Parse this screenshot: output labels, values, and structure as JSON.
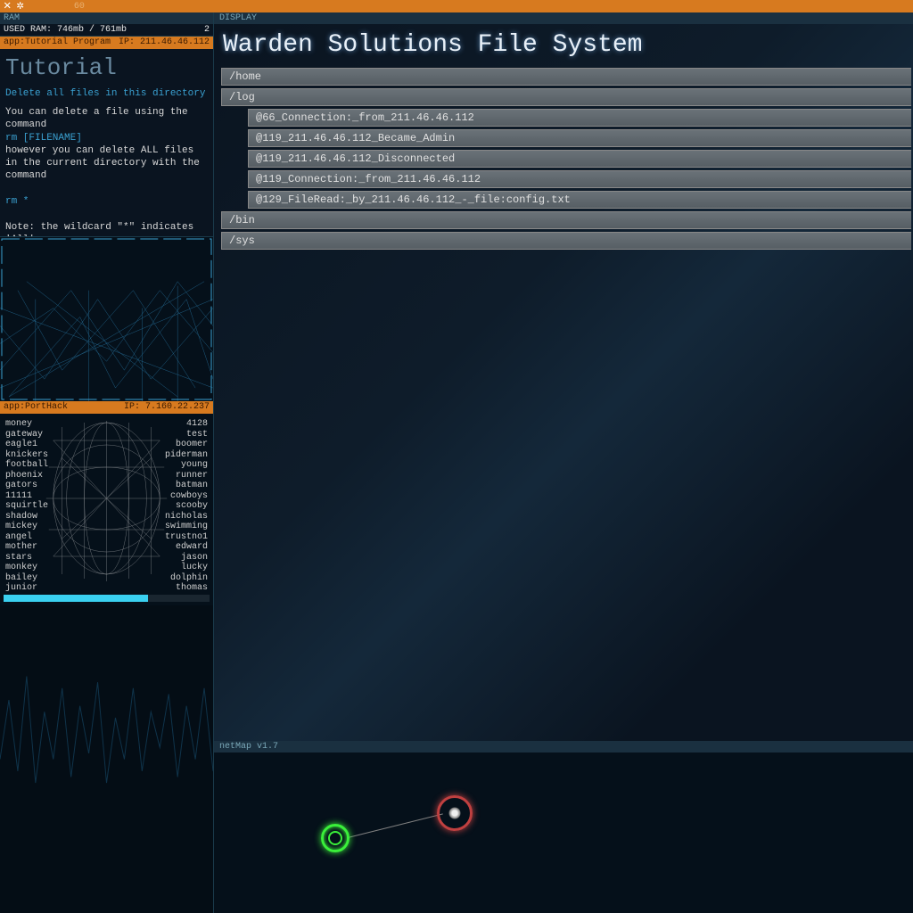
{
  "topbar": {
    "fps": "60"
  },
  "ram": {
    "label": "RAM",
    "used_line": "USED RAM: 746mb / 761mb",
    "count": "2",
    "app_tutorial": "app:Tutorial Program",
    "ip_tutorial": "IP: 211.46.46.112"
  },
  "tutorial": {
    "title": "Tutorial",
    "subtitle": "Delete all files in this directory",
    "line1": "You can delete a file using the command",
    "cmd1": "rm [FILENAME]",
    "line2": "however you can delete ALL files in the current directory with the command",
    "cmd2": "rm *",
    "note": "Note: the wildcard \"*\" indicates 'All'."
  },
  "porthack": {
    "app": "app:PortHack",
    "ip": "IP: 7.160.22.237",
    "left_words": [
      "money",
      "gateway",
      "eagle1",
      "knickers",
      "football",
      "phoenix",
      "gators",
      "11111",
      "squirtle",
      "shadow",
      "mickey",
      "angel",
      "mother",
      "stars",
      "monkey",
      "bailey",
      "junior"
    ],
    "right_words": [
      "4128",
      "test",
      "boomer",
      "piderman",
      "young",
      "runner",
      "batman",
      "cowboys",
      "scooby",
      "nicholas",
      "swimming",
      "trustno1",
      "edward",
      "jason",
      "lucky",
      "dolphin",
      "thomas"
    ]
  },
  "display": {
    "header": "DISPLAY",
    "title": "Warden Solutions File System",
    "rows": [
      {
        "label": "/home",
        "indent": 0
      },
      {
        "label": "/log",
        "indent": 0
      },
      {
        "label": "@66_Connection:_from_211.46.46.112",
        "indent": 1
      },
      {
        "label": "@119_211.46.46.112_Became_Admin",
        "indent": 1
      },
      {
        "label": "@119_211.46.46.112_Disconnected",
        "indent": 1
      },
      {
        "label": "@119_Connection:_from_211.46.46.112",
        "indent": 1
      },
      {
        "label": "@129_FileRead:_by_211.46.46.112_-_file:config.txt",
        "indent": 1
      },
      {
        "label": "/bin",
        "indent": 0
      },
      {
        "label": "/sys",
        "indent": 0
      }
    ]
  },
  "netmap": {
    "header": "netMap v1.7"
  }
}
